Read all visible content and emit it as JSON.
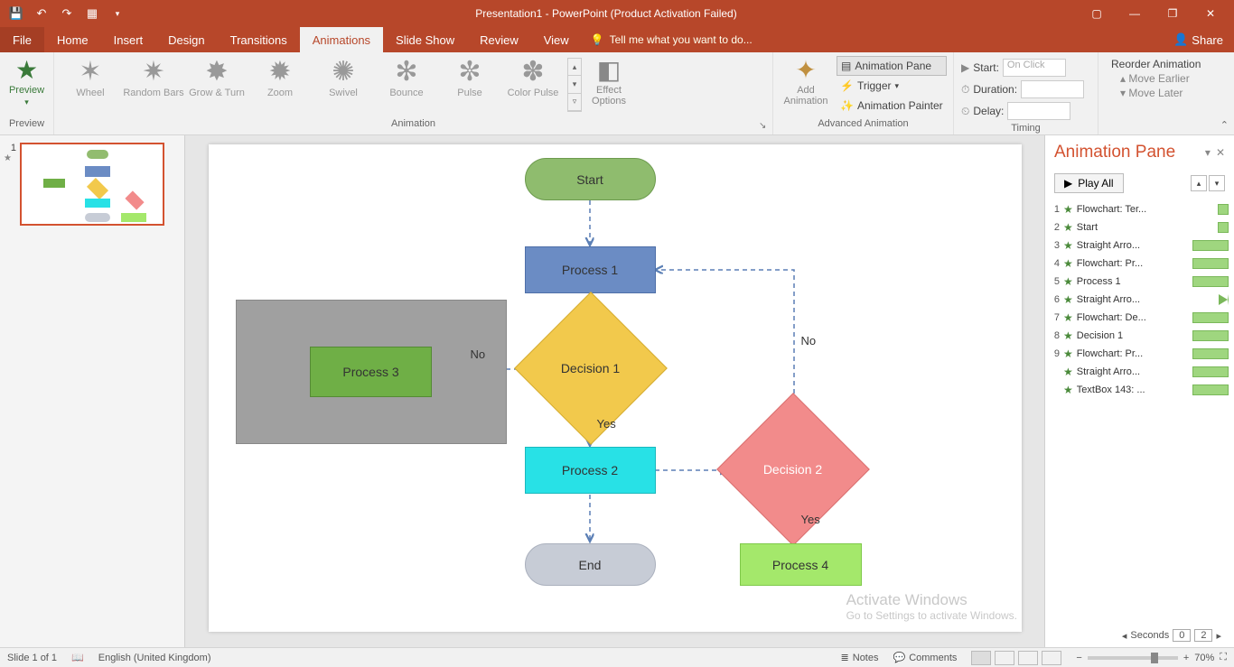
{
  "title": "Presentation1 - PowerPoint (Product Activation Failed)",
  "qat": {
    "save": "",
    "undo": "",
    "redo": "",
    "touch": ""
  },
  "window": {
    "ribbon_opts": "",
    "min": "",
    "restore": "",
    "close": ""
  },
  "tabs": {
    "file": "File",
    "home": "Home",
    "insert": "Insert",
    "design": "Design",
    "transitions": "Transitions",
    "animations": "Animations",
    "slideshow": "Slide Show",
    "review": "Review",
    "view": "View",
    "tellme": "Tell me what you want to do...",
    "share": "Share"
  },
  "ribbon": {
    "preview": {
      "label": "Preview",
      "group": "Preview"
    },
    "animation_group": "Animation",
    "gallery": [
      "Wheel",
      "Random Bars",
      "Grow & Turn",
      "Zoom",
      "Swivel",
      "Bounce",
      "Pulse",
      "Color Pulse"
    ],
    "effect_options": "Effect Options",
    "advanced_group": "Advanced Animation",
    "add_animation": "Add Animation",
    "animation_pane": "Animation Pane",
    "trigger": "Trigger",
    "animation_painter": "Animation Painter",
    "timing_group": "Timing",
    "start_label": "Start:",
    "start_value": "On Click",
    "duration_label": "Duration:",
    "duration_value": "",
    "delay_label": "Delay:",
    "delay_value": "",
    "reorder_header": "Reorder Animation",
    "move_earlier": "Move Earlier",
    "move_later": "Move Later"
  },
  "thumb": {
    "num": "1"
  },
  "flow": {
    "start": "Start",
    "p1": "Process 1",
    "p2": "Process 2",
    "p3": "Process 3",
    "p4": "Process 4",
    "d1": "Decision 1",
    "d2": "Decision 2",
    "end": "End",
    "yes": "Yes",
    "no": "No"
  },
  "watermark": {
    "l1": "Activate Windows",
    "l2": "Go to Settings to activate Windows."
  },
  "seconds": {
    "label": "Seconds",
    "a": "0",
    "b": "2"
  },
  "anim_pane": {
    "title": "Animation Pane",
    "play": "Play All",
    "items": [
      {
        "n": "1",
        "label": "Flowchart: Ter...",
        "bar": "s"
      },
      {
        "n": "2",
        "label": "Start",
        "bar": "s"
      },
      {
        "n": "3",
        "label": "Straight Arro...",
        "bar": "big"
      },
      {
        "n": "4",
        "label": "Flowchart: Pr...",
        "bar": "big"
      },
      {
        "n": "5",
        "label": "Process 1",
        "bar": "big"
      },
      {
        "n": "6",
        "label": "Straight Arro...",
        "bar": "tri"
      },
      {
        "n": "7",
        "label": "Flowchart: De...",
        "bar": "big"
      },
      {
        "n": "8",
        "label": "Decision 1",
        "bar": "big"
      },
      {
        "n": "9",
        "label": "Flowchart: Pr...",
        "bar": "big"
      },
      {
        "n": "",
        "label": "Straight Arro...",
        "bar": "big"
      },
      {
        "n": "",
        "label": "TextBox 143: ...",
        "bar": "big"
      }
    ]
  },
  "status": {
    "slide": "Slide 1 of 1",
    "lang": "English (United Kingdom)",
    "notes": "Notes",
    "comments": "Comments",
    "zoom": "70%"
  }
}
